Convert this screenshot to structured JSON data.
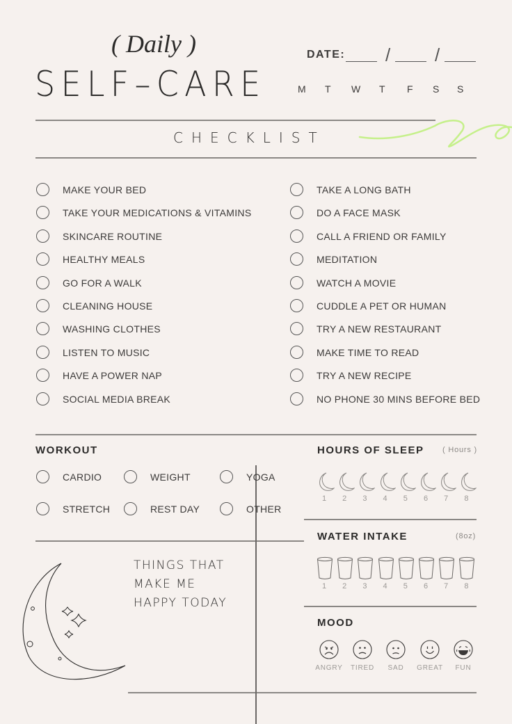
{
  "header": {
    "subtitle": "( Daily )",
    "title": "SELF–CARE",
    "date_label": "DATE:",
    "date_separator": "/",
    "weekdays": [
      "M",
      "T",
      "W",
      "T",
      "F",
      "S",
      "S"
    ],
    "section_title": "CHECKLIST",
    "accent_color": "#c5f08a"
  },
  "checklist": {
    "left": [
      {
        "label": "MAKE YOUR BED",
        "checked": false
      },
      {
        "label": "TAKE YOUR MEDICATIONS & VITAMINS",
        "checked": false
      },
      {
        "label": "SKINCARE ROUTINE",
        "checked": false
      },
      {
        "label": "HEALTHY MEALS",
        "checked": false
      },
      {
        "label": "GO FOR A WALK",
        "checked": false
      },
      {
        "label": "CLEANING HOUSE",
        "checked": false
      },
      {
        "label": "WASHING CLOTHES",
        "checked": false
      },
      {
        "label": "LISTEN TO MUSIC",
        "checked": false
      },
      {
        "label": "HAVE A POWER NAP",
        "checked": false
      },
      {
        "label": "SOCIAL MEDIA BREAK",
        "checked": false
      }
    ],
    "right": [
      {
        "label": "TAKE A LONG BATH",
        "checked": false
      },
      {
        "label": "DO A FACE MASK",
        "checked": false
      },
      {
        "label": "CALL A FRIEND OR FAMILY",
        "checked": false
      },
      {
        "label": "MEDITATION",
        "checked": false
      },
      {
        "label": "WATCH A MOVIE",
        "checked": false
      },
      {
        "label": "CUDDLE A PET OR HUMAN",
        "checked": false
      },
      {
        "label": "TRY A NEW RESTAURANT",
        "checked": false
      },
      {
        "label": "MAKE TIME TO READ",
        "checked": false
      },
      {
        "label": "TRY A NEW RECIPE",
        "checked": false
      },
      {
        "label": "NO PHONE 30 MINS BEFORE BED",
        "checked": false
      }
    ]
  },
  "workout": {
    "title": "WORKOUT",
    "options": [
      {
        "label": "CARDIO",
        "checked": false
      },
      {
        "label": "WEIGHT",
        "checked": false
      },
      {
        "label": "YOGA",
        "checked": false
      },
      {
        "label": "STRETCH",
        "checked": false
      },
      {
        "label": "REST DAY",
        "checked": false
      },
      {
        "label": "OTHER",
        "checked": false
      }
    ]
  },
  "sleep": {
    "title": "HOURS OF SLEEP",
    "unit": "( Hours )",
    "icon": "moon-icon",
    "numbers": [
      "1",
      "2",
      "3",
      "4",
      "5",
      "6",
      "7",
      "8"
    ]
  },
  "water": {
    "title": "WATER INTAKE",
    "unit": "(8oz)",
    "icon": "glass-icon",
    "numbers": [
      "1",
      "2",
      "3",
      "4",
      "5",
      "6",
      "7",
      "8"
    ]
  },
  "mood": {
    "title": "MOOD",
    "options": [
      {
        "label": "ANGRY",
        "icon": "angry-face-icon"
      },
      {
        "label": "TIRED",
        "icon": "tired-face-icon"
      },
      {
        "label": "SAD",
        "icon": "sad-face-icon"
      },
      {
        "label": "GREAT",
        "icon": "smile-face-icon"
      },
      {
        "label": "FUN",
        "icon": "laughing-face-icon"
      }
    ]
  },
  "happy": {
    "lines": [
      "THINGS THAT",
      "MAKE ME",
      "HAPPY TODAY"
    ],
    "illustration": "crescent-moon-stars-icon"
  }
}
